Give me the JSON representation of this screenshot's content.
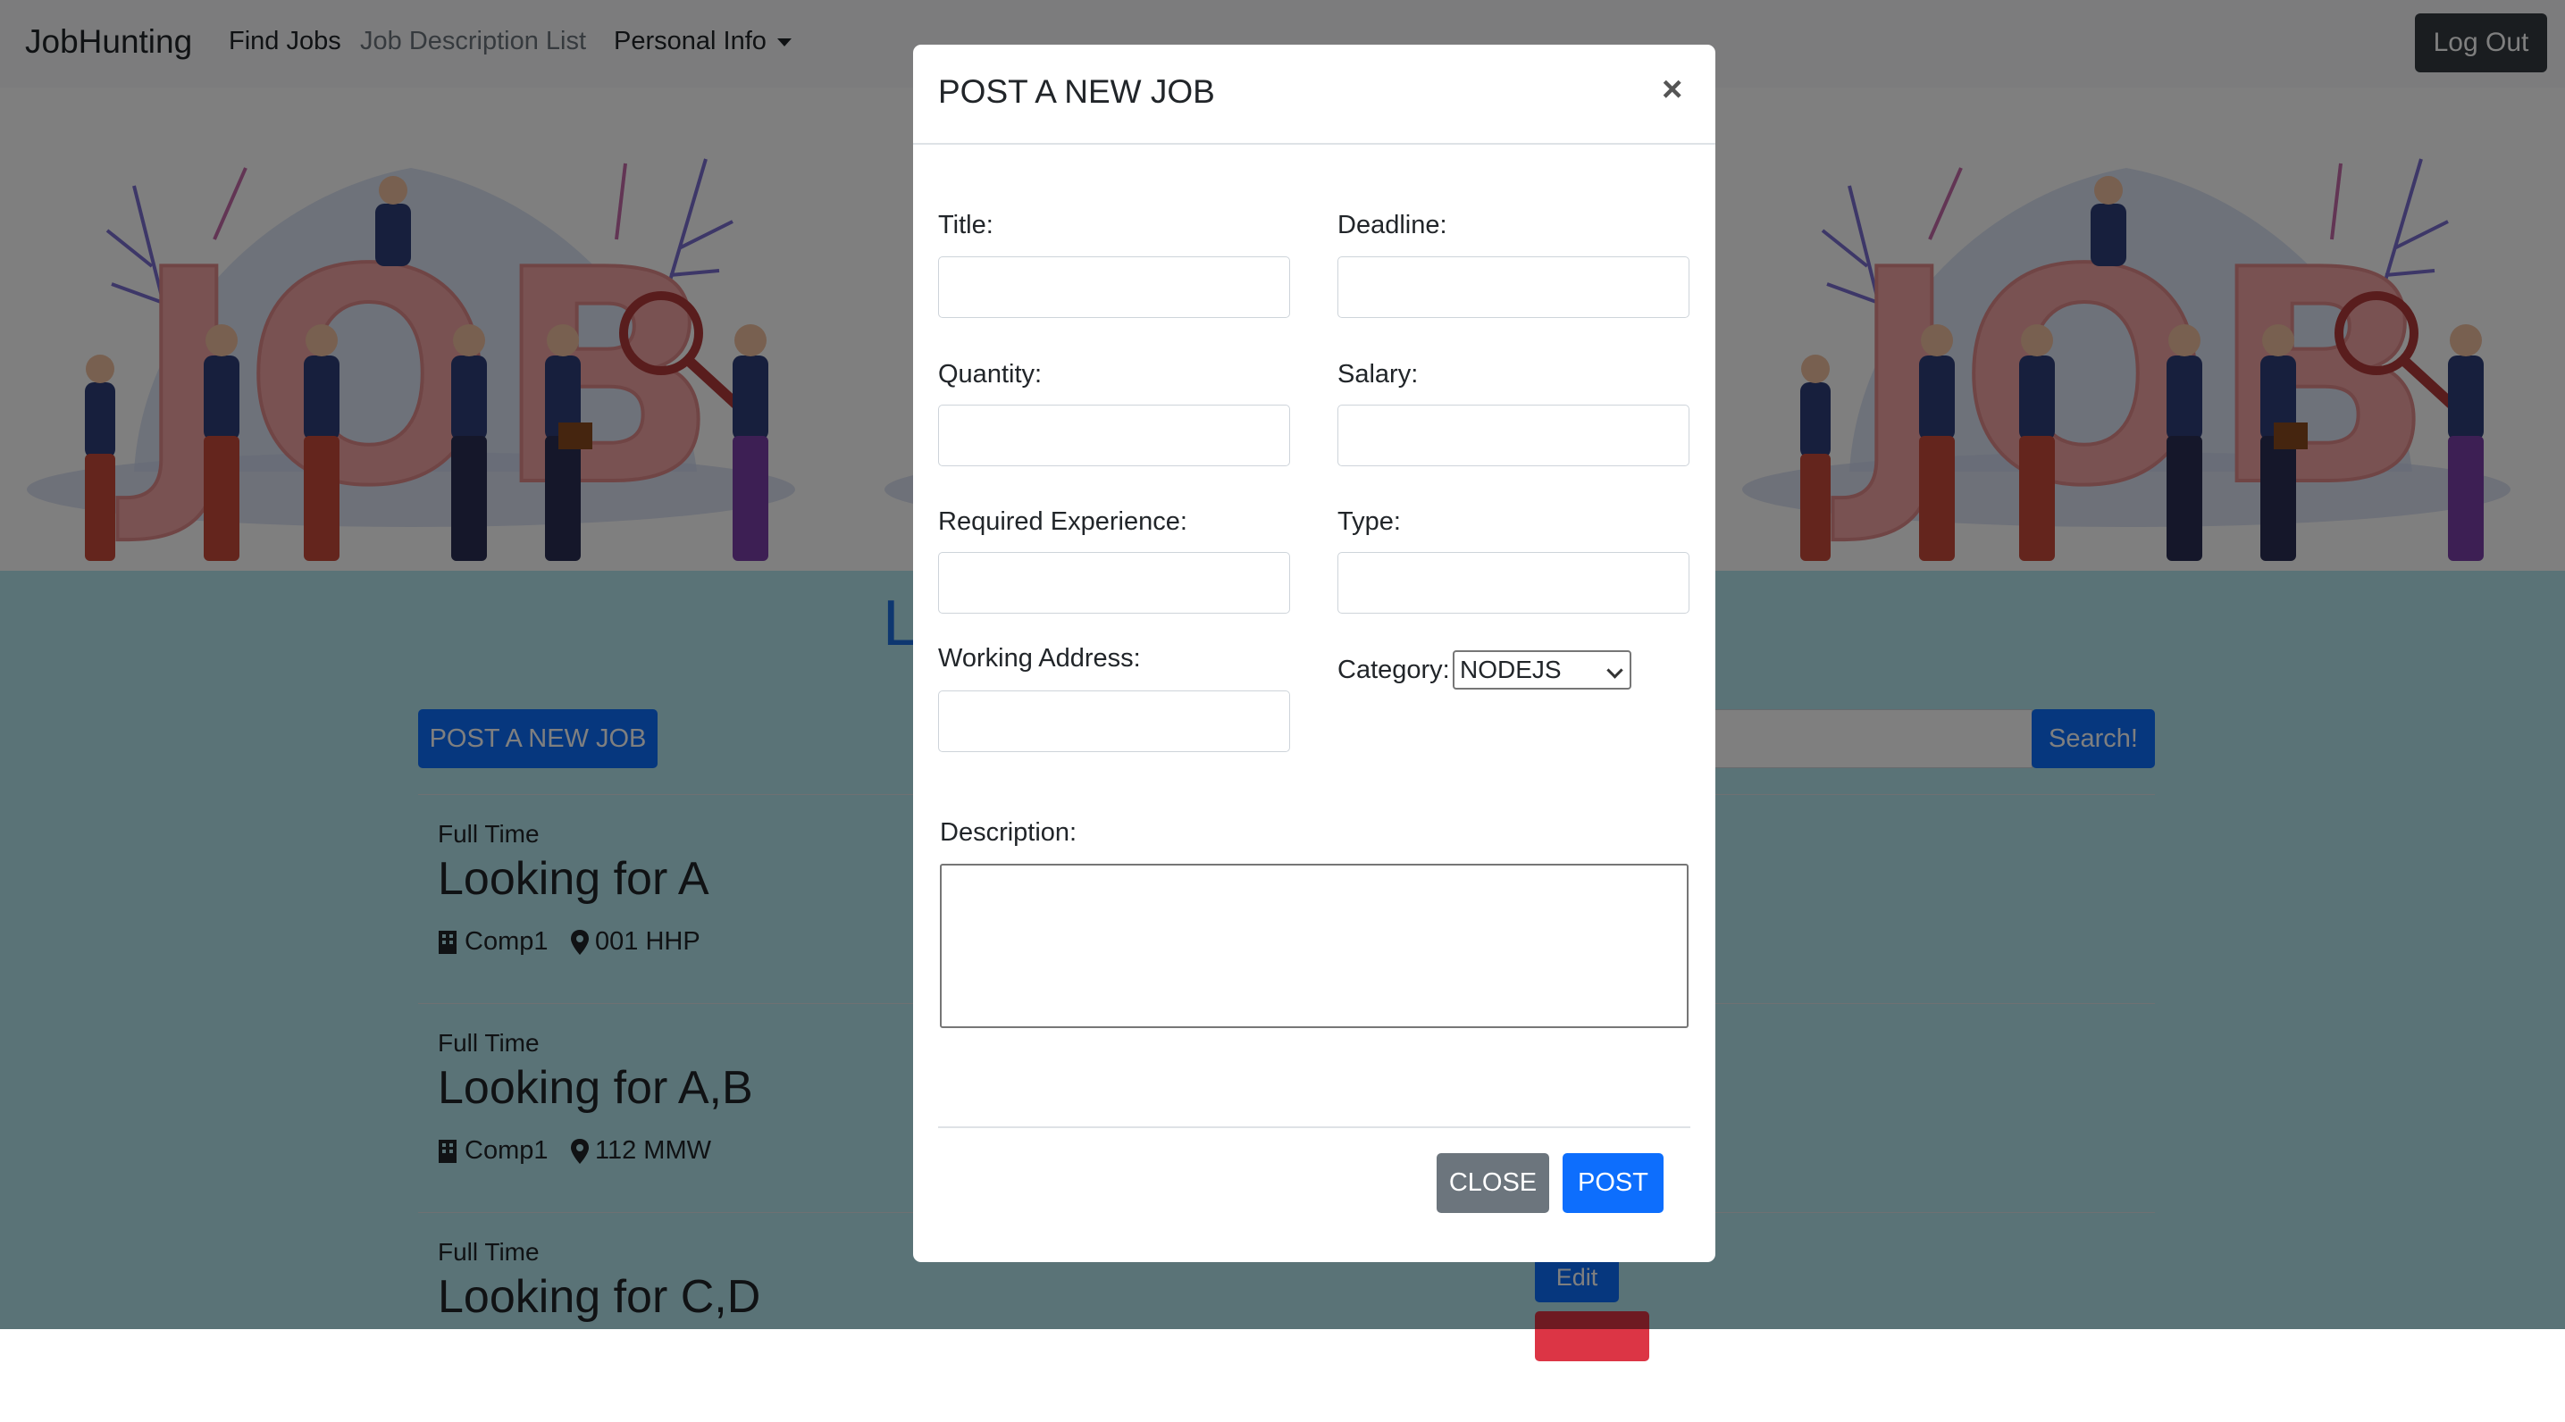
{
  "navbar": {
    "brand": "JobHunting",
    "find_jobs": "Find Jobs",
    "job_description_list": "Job Description List",
    "personal_info": "Personal Info",
    "logout": "Log Out"
  },
  "hero": {
    "banner_text": "JOB"
  },
  "content": {
    "list_title_visible": "L",
    "post_new_job": "POST A NEW JOB",
    "search_button": "Search!",
    "jobs": [
      {
        "type": "Full Time",
        "title": "Looking for A",
        "company": "Comp1",
        "address": "001 HHP"
      },
      {
        "type": "Full Time",
        "title": "Looking for A,B",
        "company": "Comp1",
        "address": "112 MMW"
      },
      {
        "type": "Full Time",
        "title": "Looking for C,D",
        "edit_label": "Edit"
      }
    ]
  },
  "modal": {
    "title": "POST A NEW JOB",
    "close_symbol": "×",
    "fields": {
      "title_label": "Title:",
      "deadline_label": "Deadline:",
      "quantity_label": "Quantity:",
      "salary_label": "Salary:",
      "required_experience_label": "Required Experience:",
      "type_label": "Type:",
      "working_address_label": "Working Address:",
      "category_label": "Category:",
      "category_selected": "NODEJS",
      "description_label": "Description:"
    },
    "close_button": "CLOSE",
    "post_button": "POST"
  },
  "colors": {
    "primary": "#0d6efd",
    "secondary": "#6c757d",
    "danger": "#dc3545",
    "dark": "#343a40",
    "content_bg": "#b5e6ee",
    "hero_letters": "#f2a4a4"
  }
}
